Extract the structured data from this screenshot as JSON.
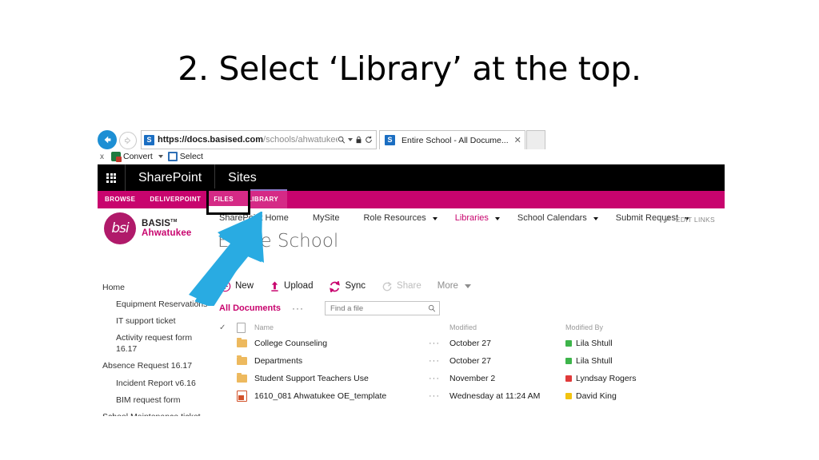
{
  "slide": {
    "title": "2. Select ‘Library’ at the top."
  },
  "browser": {
    "back_icon": "back-arrow-icon",
    "forward_icon": "forward-arrow-icon",
    "address": {
      "favicon": "sharepoint-favicon",
      "scheme": "https://",
      "host_prefix": "docs.",
      "host_bold": "basised.com",
      "path": "/schools/ahwatukee/_layc",
      "search_icon": "search-icon",
      "lock_icon": "lock-icon",
      "refresh_icon": "refresh-icon"
    },
    "tab": {
      "favicon": "sharepoint-favicon",
      "title": "Entire School - All Docume...",
      "close_icon": "close-icon"
    }
  },
  "addin_bar": {
    "close_label": "x",
    "items": [
      {
        "label": "Convert",
        "icon": "convert-icon",
        "has_caret": true
      },
      {
        "label": "Select",
        "icon": "select-icon",
        "has_caret": false
      }
    ]
  },
  "suitebar": {
    "waffle_icon": "app-launcher-icon",
    "brand": "SharePoint",
    "site": "Sites"
  },
  "ribbon": {
    "tabs": [
      {
        "label": "BROWSE",
        "state": "normal"
      },
      {
        "label": "DELIVERPOINT",
        "state": "normal"
      },
      {
        "label": "FILES",
        "state": "selected"
      },
      {
        "label": "LIBRARY",
        "state": "selected-highlighted"
      }
    ],
    "highlight_color": "#000000",
    "bar_color": "#c8046e"
  },
  "topnav": {
    "items": [
      {
        "label": "SharePoint Home",
        "active": false,
        "caret": false
      },
      {
        "label": "MySite",
        "active": false,
        "caret": false
      },
      {
        "label": "Role Resources",
        "active": false,
        "caret": true
      },
      {
        "label": "Libraries",
        "active": true,
        "caret": true
      },
      {
        "label": "School Calendars",
        "active": false,
        "caret": true
      },
      {
        "label": "Submit Request",
        "active": false,
        "caret": true
      }
    ],
    "edit_links": "EDIT LINKS",
    "edit_links_icon": "pencil-icon"
  },
  "branding": {
    "logo_mark": "bsi",
    "logo_line1": "BASIS",
    "logo_line1_sup": "TM",
    "logo_line2": "Ahwatukee",
    "site_title": "Entire School",
    "logo_color": "#b01a6a",
    "accent_color": "#c8046e"
  },
  "quicklaunch": {
    "items": [
      {
        "label": "Home",
        "indent": false
      },
      {
        "label": "Equipment Reservations",
        "indent": true
      },
      {
        "label": "IT support ticket",
        "indent": true
      },
      {
        "label": "Activity request form 16.17",
        "indent": true
      },
      {
        "label": "Absence Request 16.17",
        "indent": false
      },
      {
        "label": "Incident Report v6.16",
        "indent": true
      },
      {
        "label": "BIM request form",
        "indent": true
      },
      {
        "label": "School Maintenance ticket",
        "indent": false
      }
    ]
  },
  "commands": [
    {
      "label": "New",
      "icon": "new-plus-icon",
      "disabled": false
    },
    {
      "label": "Upload",
      "icon": "upload-arrow-icon",
      "disabled": false
    },
    {
      "label": "Sync",
      "icon": "sync-icon",
      "disabled": false
    },
    {
      "label": "Share",
      "icon": "share-icon",
      "disabled": true
    },
    {
      "label": "More",
      "icon": "chevron-down-icon",
      "disabled": false
    }
  ],
  "view": {
    "current": "All Documents",
    "ellipsis": "···",
    "search_placeholder": "Find a file",
    "search_value": "",
    "search_icon": "search-icon"
  },
  "file_list": {
    "headers": {
      "check": "check-icon",
      "type": "document-type-icon",
      "name": "Name",
      "modified": "Modified",
      "modified_by": "Modified By"
    },
    "rows": [
      {
        "icon": "folder-icon",
        "name": "College Counseling",
        "ellipsis": "···",
        "modified": "October 27",
        "modified_by": "Lila Shtull",
        "presence": "available",
        "presence_color": "#3db44a"
      },
      {
        "icon": "folder-icon",
        "name": "Departments",
        "ellipsis": "···",
        "modified": "October 27",
        "modified_by": "Lila Shtull",
        "presence": "available",
        "presence_color": "#3db44a"
      },
      {
        "icon": "folder-icon",
        "name": "Student Support Teachers Use",
        "ellipsis": "···",
        "modified": "November 2",
        "modified_by": "Lyndsay Rogers",
        "presence": "busy",
        "presence_color": "#e03a3a"
      },
      {
        "icon": "powerpoint-icon",
        "name": "1610_081 Ahwatukee OE_template",
        "ellipsis": "···",
        "modified": "Wednesday at 11:24 AM",
        "modified_by": "David King",
        "presence": "away",
        "presence_color": "#f2c310"
      }
    ]
  },
  "annotation": {
    "arrow_icon": "blue-arrow-pointing-up-right",
    "arrow_color": "#29ABE2"
  }
}
